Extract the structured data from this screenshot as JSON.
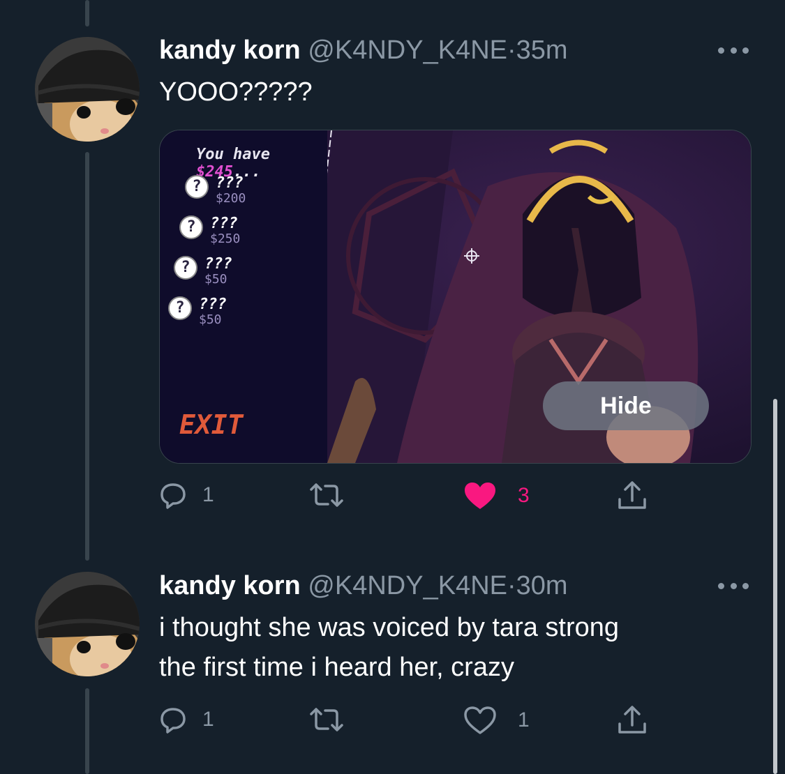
{
  "tweets": [
    {
      "name": "kandy korn",
      "handle": "@K4NDY_K4NE",
      "separator": "·",
      "time": "35m",
      "text_lines": [
        "YOOO?????"
      ],
      "media": {
        "shop_header_prefix": "You have ",
        "shop_money": "$245",
        "shop_header_suffix": "...",
        "items": [
          {
            "icon": "?",
            "name": "???",
            "price": "$200"
          },
          {
            "icon": "?",
            "name": "???",
            "price": "$250"
          },
          {
            "icon": "?",
            "name": "???",
            "price": "$50"
          },
          {
            "icon": "?",
            "name": "???",
            "price": "$50"
          }
        ],
        "exit_label": "EXIT",
        "hide_label": "Hide"
      },
      "actions": {
        "reply_count": "1",
        "retweet_count": "",
        "like_count": "3",
        "liked": true
      }
    },
    {
      "name": "kandy korn",
      "handle": "@K4NDY_K4NE",
      "separator": "·",
      "time": "30m",
      "text_lines": [
        "i thought she was voiced by tara strong",
        "the first time i heard her, crazy"
      ],
      "actions": {
        "reply_count": "1",
        "retweet_count": "",
        "like_count": "1",
        "liked": false
      }
    }
  ],
  "colors": {
    "background": "#15202b",
    "secondary_text": "#8b98a5",
    "like": "#f91880",
    "accent_money": "#e04fd0",
    "exit": "#e05a3a"
  },
  "icons": [
    "reply-icon",
    "retweet-icon",
    "like-icon",
    "share-icon",
    "more-icon"
  ]
}
